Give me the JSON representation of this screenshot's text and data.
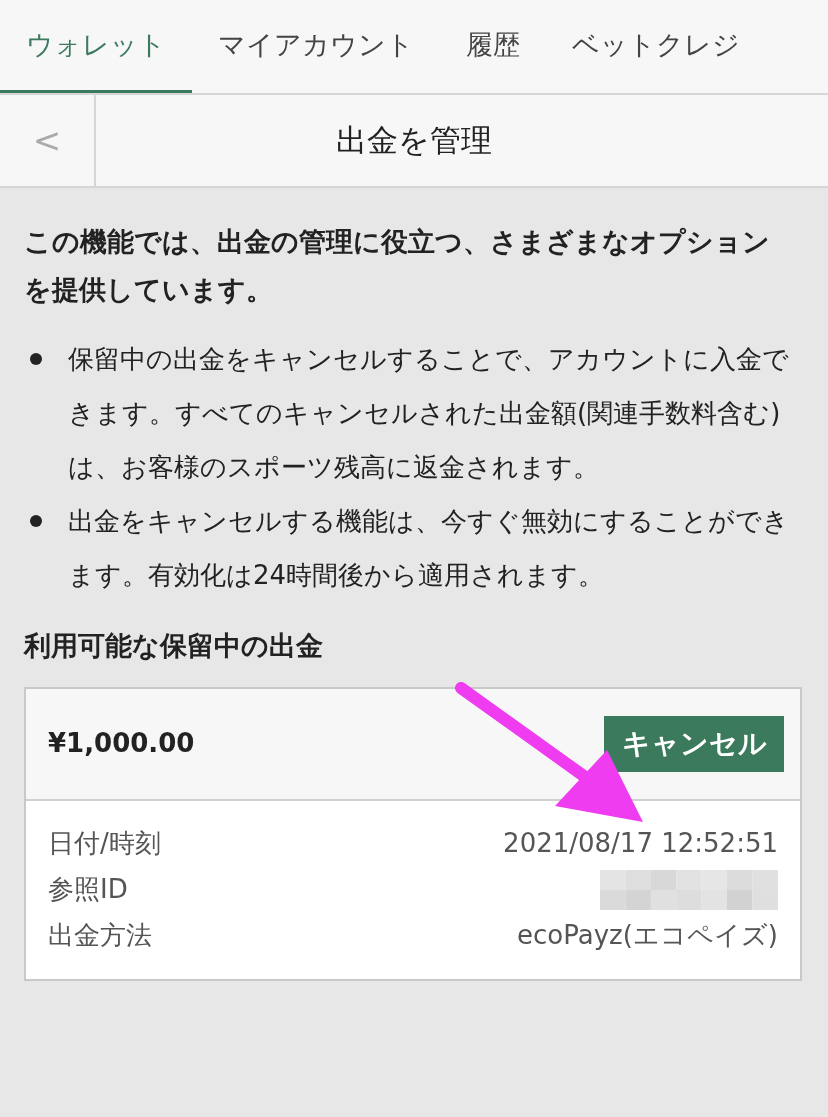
{
  "tabs": [
    {
      "label": "ウォレット",
      "selected": true
    },
    {
      "label": "マイアカウント",
      "selected": false
    },
    {
      "label": "履歴",
      "selected": false
    },
    {
      "label": "ベットクレジ",
      "selected": false
    }
  ],
  "header": {
    "back": "<",
    "title": "出金を管理"
  },
  "intro": "この機能では、出金の管理に役立つ、さまざまなオプションを提供しています。",
  "bullets": [
    "保留中の出金をキャンセルすることで、アカウントに入金できます。すべてのキャンセルされた出金額(関連手数料含む)は、お客様のスポーツ残高に返金されます。",
    "出金をキャンセルする機能は、今すぐ無効にすることができます。有効化は24時間後から適用されます。"
  ],
  "section_title": "利用可能な保留中の出金",
  "withdrawal": {
    "amount": "¥1,000.00",
    "cancel_button": "キャンセル",
    "details": [
      {
        "label": "日付/時刻",
        "value": "2021/08/17 12:52:51",
        "kind": "text"
      },
      {
        "label": "参照ID",
        "kind": "masked"
      },
      {
        "label": "出金方法",
        "value": "ecoPayz(エコペイズ)",
        "kind": "text"
      }
    ]
  }
}
